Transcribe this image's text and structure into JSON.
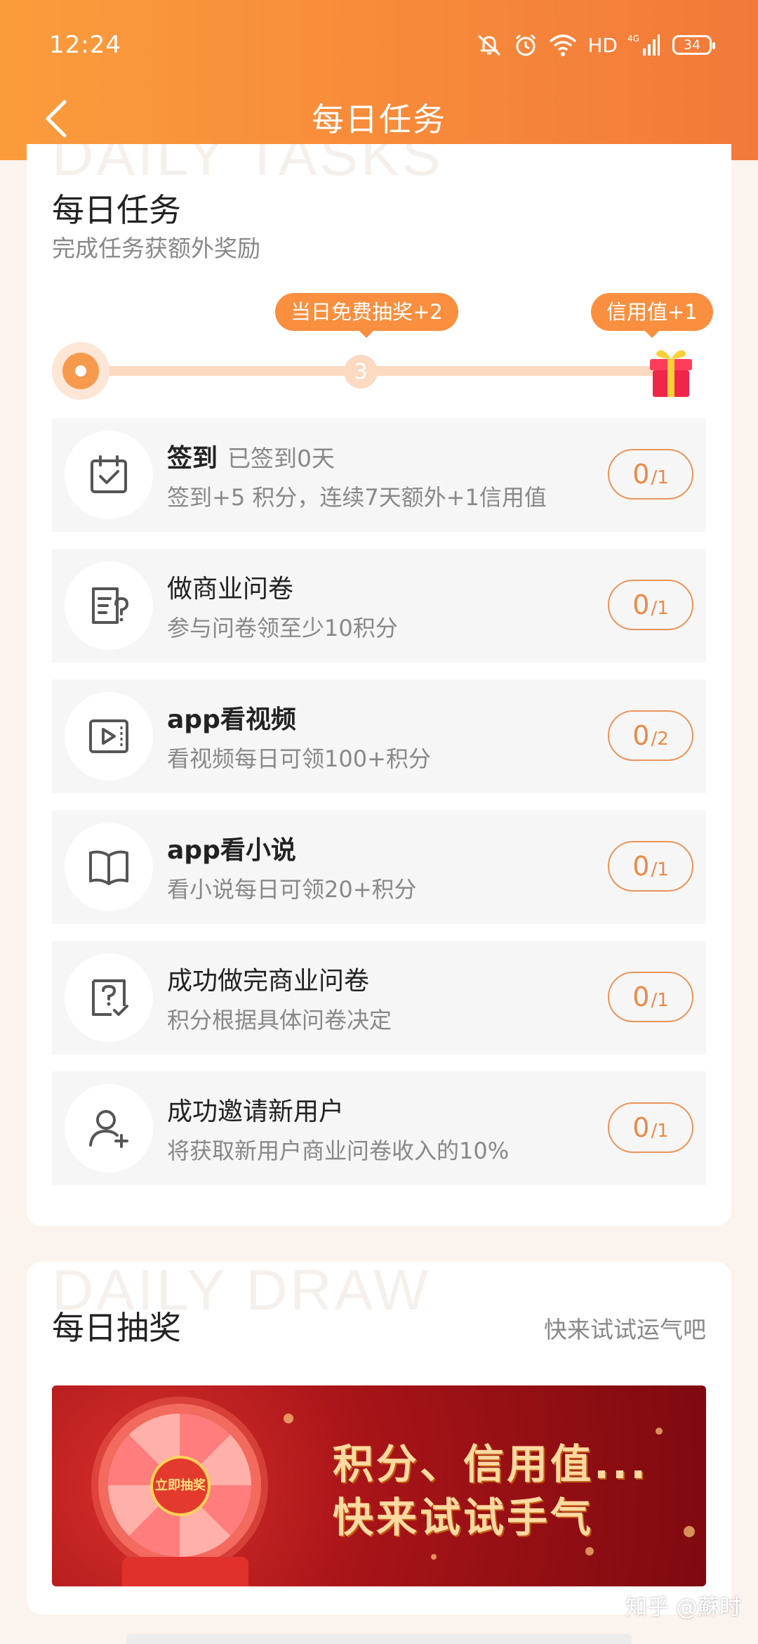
{
  "status_bar": {
    "time": "12:24",
    "network": "HD",
    "signal_label": "4G",
    "battery": "34"
  },
  "nav": {
    "title": "每日任务"
  },
  "tasks_section": {
    "watermark": "DAILY TASKS",
    "title": "每日任务",
    "subtitle": "完成任务获额外奖励",
    "progress": {
      "milestone_value": "3",
      "milestone_tip": "当日免费抽奖+2",
      "final_tip": "信用值+1",
      "completed_fraction": 0
    },
    "items": [
      {
        "title": "签到",
        "title_note": "已签到0天",
        "desc": "签到+5 积分，连续7天额外+1信用值",
        "done": "0",
        "total": "/1",
        "icon": "calendar-check-icon"
      },
      {
        "title": "做商业问卷",
        "title_note": "",
        "desc": "参与问卷领至少10积分",
        "done": "0",
        "total": "/1",
        "icon": "survey-icon"
      },
      {
        "title": "app看视频",
        "title_note": "",
        "desc": "看视频每日可领100+积分",
        "done": "0",
        "total": "/2",
        "icon": "video-icon"
      },
      {
        "title": "app看小说",
        "title_note": "",
        "desc": "看小说每日可领20+积分",
        "done": "0",
        "total": "/1",
        "icon": "book-icon"
      },
      {
        "title": "成功做完商业问卷",
        "title_note": "",
        "desc": "积分根据具体问卷决定",
        "done": "0",
        "total": "/1",
        "icon": "question-check-icon"
      },
      {
        "title": "成功邀请新用户",
        "title_note": "",
        "desc": "将获取新用户商业问卷收入的10%",
        "done": "0",
        "total": "/1",
        "icon": "add-user-icon"
      }
    ]
  },
  "draw_section": {
    "watermark": "DAILY DRAW",
    "title": "每日抽奖",
    "subtitle": "快来试试运气吧",
    "banner": {
      "line1": "积分、信用值...",
      "line2": "快来试试手气",
      "wheel_center": "立即抽奖"
    }
  },
  "corner_watermark": "知乎 @蘇时",
  "colors": {
    "accent": "#f6883a",
    "button_border": "#e9955a",
    "track": "#fcd9c1"
  }
}
